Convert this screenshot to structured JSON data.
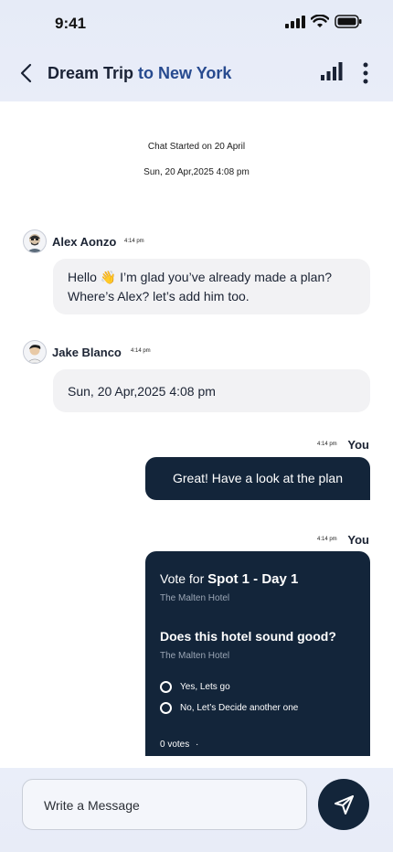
{
  "status": {
    "time": "9:41"
  },
  "header": {
    "title_main": "Dream Trip ",
    "title_accent": "to New York"
  },
  "chat": {
    "started_label": "Chat Started on 20 April",
    "started_datetime": "Sun, 20 Apr,2025 4:08 pm",
    "messages": [
      {
        "sender": "Alex Aonzo",
        "time": "4:14 pm",
        "text": "Hello 👋 I’m glad you’ve already made a plan? Where’s Alex? let’s add him too."
      },
      {
        "sender": "Jake Blanco",
        "time": "4:14 pm",
        "text": "Sun, 20 Apr,2025 4:08 pm"
      },
      {
        "sender": "You",
        "time": "4:14 pm",
        "text": "Great! Have a look at the plan"
      }
    ],
    "poll": {
      "sender": "You",
      "time": "4:14 pm",
      "vote_prefix": "Vote for ",
      "vote_title": "Spot 1 - Day 1",
      "subtitle": "The Malten Hotel",
      "question": "Does this hotel sound good?",
      "question_sub": "The Malten Hotel",
      "options": [
        "Yes, Lets go",
        "No, Let’s Decide another one"
      ],
      "votes": "0 votes",
      "votes_sep": "·"
    }
  },
  "composer": {
    "placeholder": "Write a Message"
  },
  "colors": {
    "accent": "#274a8f",
    "dark_bubble": "#13253a",
    "light_bubble": "#f2f2f4"
  }
}
